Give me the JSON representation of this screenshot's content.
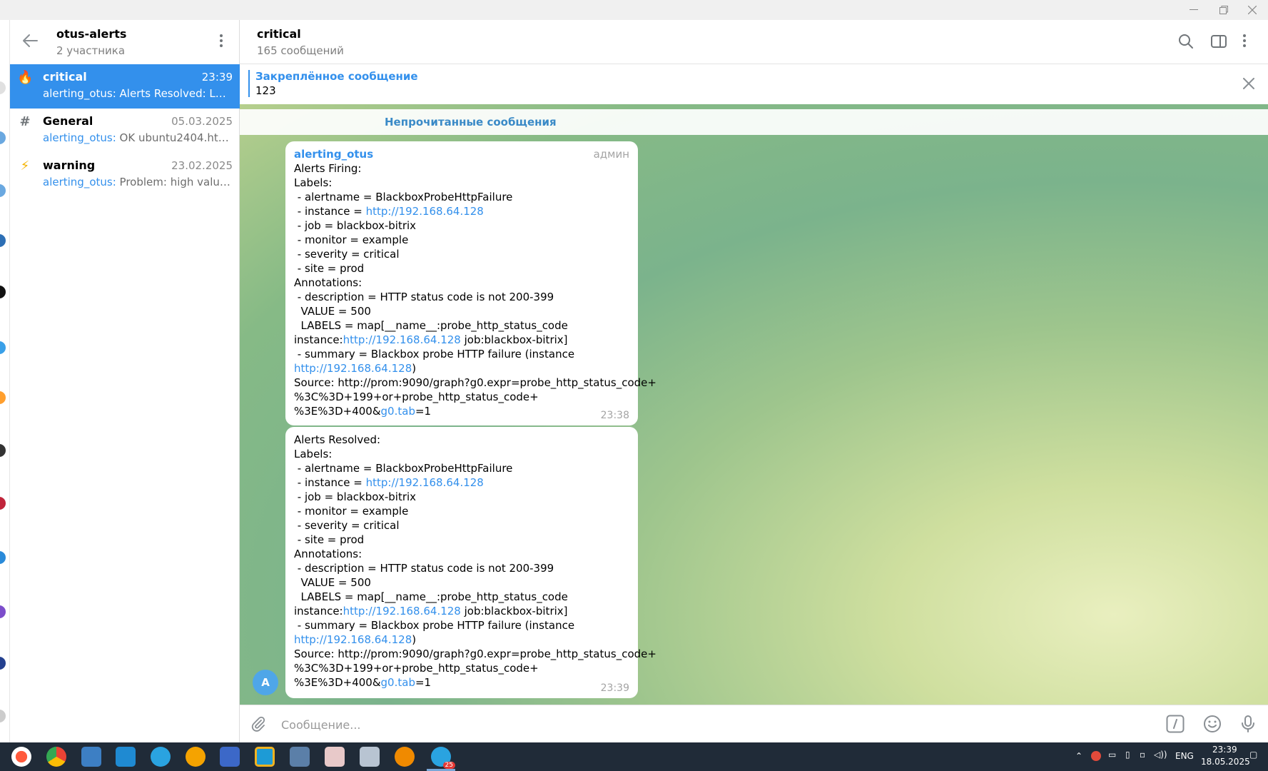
{
  "window": {
    "minimize_icon": "minimize-icon",
    "restore_icon": "restore-icon",
    "close_icon": "close-icon"
  },
  "chat_list": {
    "group_title": "otus-alerts",
    "group_subtitle": "2 участника",
    "chats": [
      {
        "icon": "fire-icon",
        "name": "critical",
        "time": "23:39",
        "sender": "",
        "preview": "alerting_otus: Alerts Resolved: Label...",
        "active": true
      },
      {
        "icon": "hash-icon",
        "name": "General",
        "time": "05.03.2025",
        "sender": "alerting_otus:",
        "preview": " OK ubuntu2404.httpre...",
        "active": false
      },
      {
        "icon": "lightning-icon",
        "name": "warning",
        "time": "23.02.2025",
        "sender": "alerting_otus:",
        "preview": " Problem: high value N...",
        "active": false
      }
    ]
  },
  "chat_header": {
    "title": "critical",
    "subtitle": "165 сообщений"
  },
  "pinned": {
    "title": "Закреплённое сообщение",
    "text": "123"
  },
  "unread_label": "Непрочитанные сообщения",
  "messages": [
    {
      "sender": "alerting_otus",
      "role": "админ",
      "time": "23:38",
      "lines": [
        "Alerts Firing:",
        "Labels:",
        " - alertname = BlackboxProbeHttpFailure",
        " - instance = ",
        " - job = blackbox-bitrix",
        " - monitor = example",
        " - severity = critical",
        " - site = prod",
        "Annotations:",
        " - description = HTTP status code is not 200-399",
        "  VALUE = 500",
        "  LABELS = map[__name__:probe_http_status_code",
        "instance:",
        " job:blackbox-bitrix]",
        " - summary = Blackbox probe HTTP failure (instance",
        ")",
        "Source: http://prom:9090/graph?g0.expr=probe_http_status_code+",
        "%3C%3D+199+or+probe_http_status_code+",
        "%3E%3D+400&",
        "=1"
      ],
      "link_instance": "http://192.168.64.128",
      "link_tab": "g0.tab"
    },
    {
      "sender": "",
      "role": "",
      "time": "23:39",
      "lines": [
        "Alerts Resolved:",
        "Labels:",
        " - alertname = BlackboxProbeHttpFailure",
        " - instance = ",
        " - job = blackbox-bitrix",
        " - monitor = example",
        " - severity = critical",
        " - site = prod",
        "Annotations:",
        " - description = HTTP status code is not 200-399",
        "  VALUE = 500",
        "  LABELS = map[__name__:probe_http_status_code",
        "instance:",
        " job:blackbox-bitrix]",
        " - summary = Blackbox probe HTTP failure (instance",
        ")",
        "Source: http://prom:9090/graph?g0.expr=probe_http_status_code+",
        "%3C%3D+199+or+probe_http_status_code+",
        "%3E%3D+400&",
        "=1"
      ],
      "link_instance": "http://192.168.64.128",
      "link_tab": "g0.tab"
    }
  ],
  "avatar_letter": "A",
  "composer": {
    "placeholder": "Сообщение..."
  },
  "taskbar": {
    "apps": [
      "yandex-browser-icon",
      "chrome-icon",
      "image-viewer-icon",
      "vscode-icon",
      "telegram-icon",
      "aimp-icon",
      "file-manager-icon",
      "folder-icon",
      "virtualbox-icon",
      "app-icon",
      "app-icon-2",
      "blender-icon",
      "telegram-icon-active"
    ],
    "badge": "25",
    "lang": "ENG",
    "time": "23:39",
    "date": "18.05.2025"
  },
  "colors": {
    "accent": "#3390ec",
    "taskbar": "#202b38"
  }
}
